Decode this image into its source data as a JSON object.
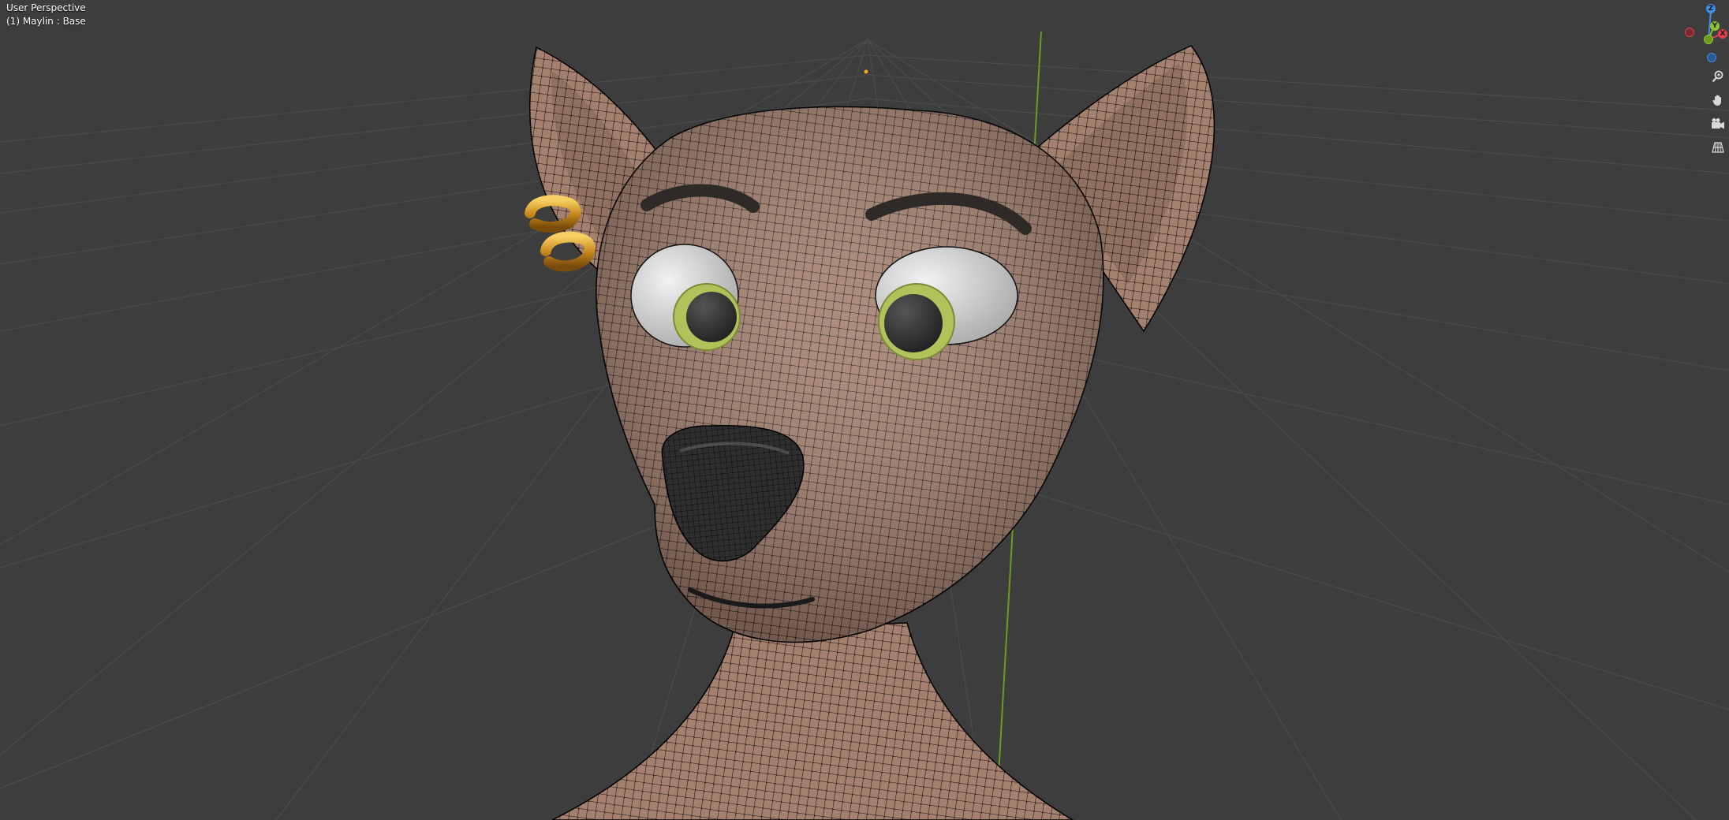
{
  "viewport": {
    "title": "User Perspective",
    "object_label": "(1) Maylin : Base"
  },
  "gizmo": {
    "z_label": "Z",
    "y_label": "Y",
    "x_label": "X",
    "colors": {
      "x": "#e2404f",
      "y": "#8cc232",
      "z": "#3f8ee5"
    }
  },
  "nav_tools": [
    {
      "icon": "zoom-icon"
    },
    {
      "icon": "hand-pan-icon"
    },
    {
      "icon": "camera-icon"
    },
    {
      "icon": "grid-perspective-icon"
    }
  ],
  "colors": {
    "background": "#3d3d3d",
    "skin": "#a07a6c",
    "wire": "#141010",
    "eye_white": "#e4e4e4",
    "iris": "#b2c25a",
    "pupil": "#2c2c2c",
    "earring": "#d49a26",
    "nose": "#383838"
  }
}
